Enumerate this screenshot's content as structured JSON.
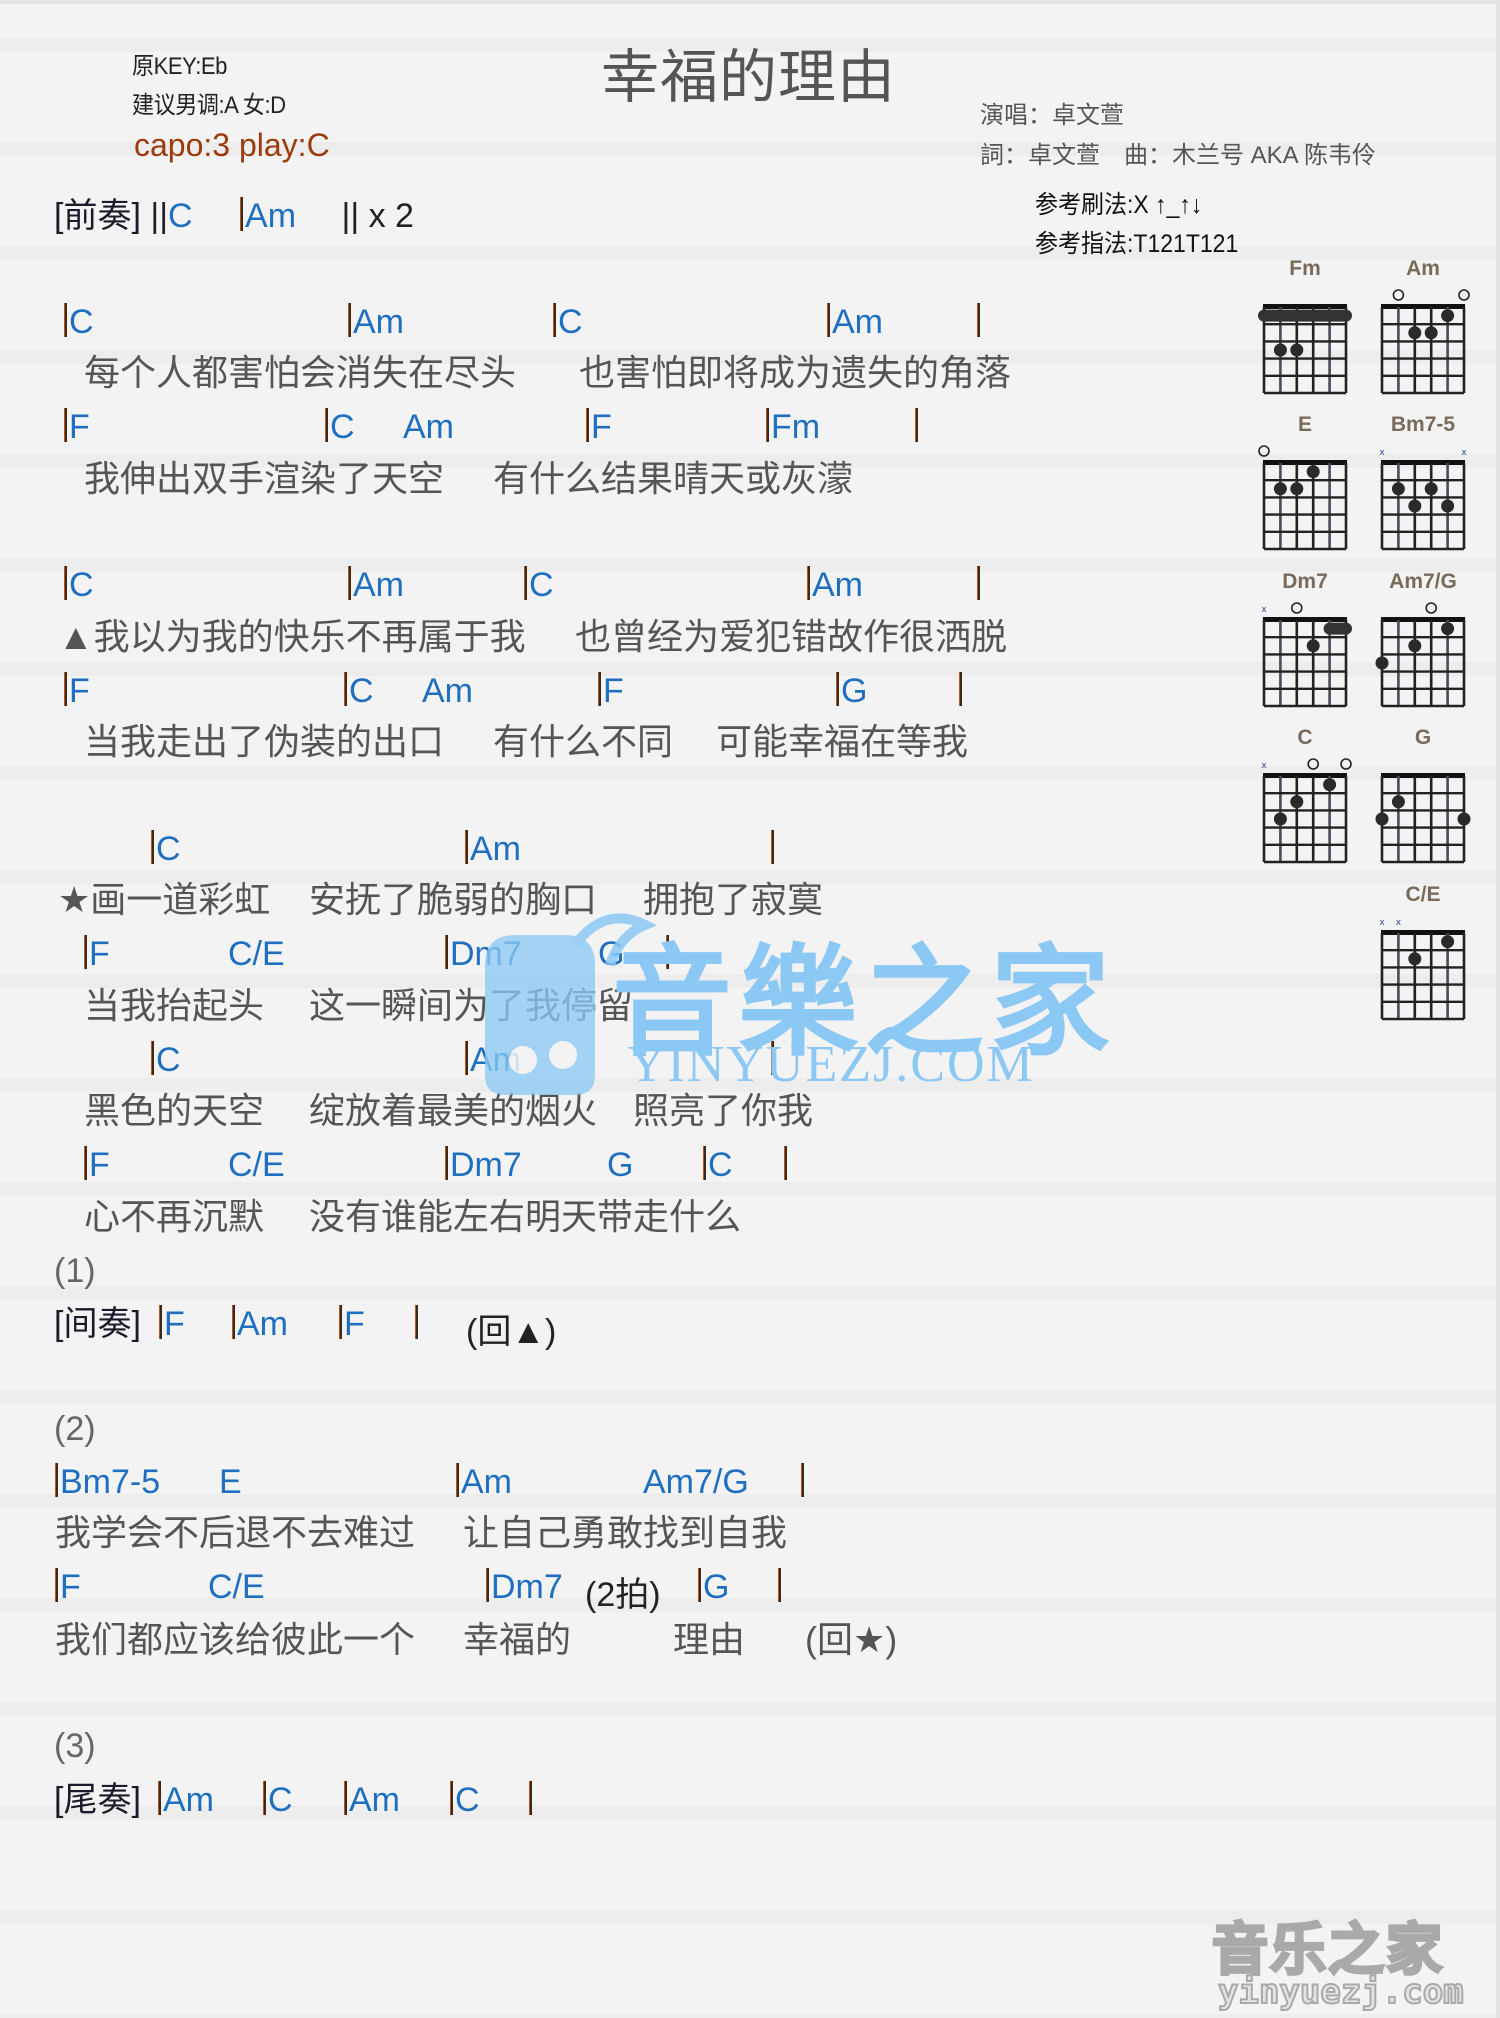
{
  "header": {
    "original_key": "原KEY:Eb",
    "suggested_key": "建议男调:A 女:D",
    "capo": "capo:3 play:C",
    "title": "幸福的理由",
    "singer": "演唱：卓文萱",
    "credits": "詞：卓文萱　曲：木兰号 AKA 陈韦伶",
    "strum_pattern": "参考刷法:X ↑_↑↓",
    "finger_pattern": "参考指法:T121T121"
  },
  "prelude": {
    "label": "[前奏]",
    "open": "||",
    "chords": [
      "C",
      "Am"
    ],
    "close": "|| x 2"
  },
  "verse1": {
    "rows": [
      {
        "chords": [
          "C",
          "Am",
          "C",
          "Am",
          ""
        ]
      },
      {
        "lyrics": [
          "每个人都害怕会消失在尽头",
          "也害怕即将成为遗失的角落"
        ]
      },
      {
        "chords": [
          "F",
          "C",
          "Am",
          "F",
          "Fm",
          ""
        ]
      },
      {
        "lyrics": [
          "我伸出双手渲染了天空",
          "有什么结果晴天或灰濛"
        ]
      }
    ]
  },
  "verse2": {
    "rows": [
      {
        "chords": [
          "C",
          "Am",
          "C",
          "Am",
          ""
        ]
      },
      {
        "lyrics": [
          "▲我以为我的快乐不再属于我",
          "也曾经为爱犯错故作很洒脱"
        ]
      },
      {
        "chords": [
          "F",
          "C",
          "Am",
          "F",
          "G",
          ""
        ]
      },
      {
        "lyrics": [
          "当我走出了伪装的出口",
          "有什么不同",
          "可能幸福在等我"
        ]
      }
    ]
  },
  "chorus": {
    "rows": [
      {
        "chords": [
          "C",
          "Am",
          ""
        ]
      },
      {
        "lyrics": [
          "★画一道彩虹",
          "安抚了脆弱的胸口",
          "拥抱了寂寞"
        ]
      },
      {
        "chords": [
          "F",
          "C/E",
          "Dm7",
          "G",
          ""
        ]
      },
      {
        "lyrics": [
          "当我抬起头",
          "这一瞬间为了我停留"
        ]
      },
      {
        "chords": [
          "C",
          "Am",
          ""
        ]
      },
      {
        "lyrics": [
          "黑色的天空",
          "绽放着最美的烟火",
          "照亮了你我"
        ]
      },
      {
        "chords": [
          "F",
          "C/E",
          "Dm7",
          "G",
          "C",
          ""
        ]
      },
      {
        "lyrics": [
          "心不再沉默",
          "没有谁能左右明天带走什么"
        ]
      }
    ]
  },
  "ending1": {
    "marker": "(1)",
    "label": "[间奏]",
    "chords": [
      "F",
      "Am",
      "F",
      ""
    ],
    "repeat": "(回▲)"
  },
  "ending2": {
    "marker": "(2)",
    "rows": [
      {
        "chords": [
          "Bm7-5",
          "E",
          "Am",
          "Am7/G",
          ""
        ]
      },
      {
        "lyrics": [
          "我学会不后退不去难过",
          "让自己勇敢找到自我"
        ]
      },
      {
        "chords": [
          "F",
          "C/E",
          "Dm7",
          "G",
          ""
        ],
        "note": "(2拍)"
      },
      {
        "lyrics": [
          "我们都应该给彼此一个",
          "幸福的",
          "理由",
          "(回★)"
        ]
      }
    ]
  },
  "ending3": {
    "marker": "(3)",
    "label": "[尾奏]",
    "chords": [
      "Am",
      "C",
      "Am",
      "C",
      ""
    ]
  },
  "chord_diagrams": [
    {
      "name": "Fm",
      "markers": [
        "",
        "",
        "",
        "",
        "",
        ""
      ],
      "barre": {
        "fret": 1,
        "from": 1,
        "to": 6
      },
      "dots": [
        [
          2,
          3
        ],
        [
          3,
          3
        ]
      ]
    },
    {
      "name": "Am",
      "markers": [
        "",
        "o",
        "",
        "",
        "",
        "o"
      ],
      "dots": [
        [
          3,
          2
        ],
        [
          4,
          2
        ],
        [
          5,
          1
        ]
      ]
    },
    {
      "name": "E",
      "markers": [
        "o",
        "",
        "",
        "",
        "",
        ""
      ],
      "dots": [
        [
          2,
          2
        ],
        [
          3,
          2
        ],
        [
          4,
          1
        ]
      ]
    },
    {
      "name": "Bm7-5",
      "markers": [
        "x",
        "",
        "",
        "",
        "",
        "x"
      ],
      "dots": [
        [
          2,
          2
        ],
        [
          4,
          2
        ],
        [
          3,
          3
        ],
        [
          5,
          3
        ]
      ]
    },
    {
      "name": "Dm7",
      "markers": [
        "x",
        "",
        "o",
        "",
        "",
        ""
      ],
      "barre": {
        "fret": 1,
        "from": 5,
        "to": 6
      },
      "dots": [
        [
          4,
          2
        ]
      ]
    },
    {
      "name": "Am7/G",
      "markers": [
        "",
        "",
        "",
        "o",
        "",
        ""
      ],
      "dots": [
        [
          1,
          3
        ],
        [
          3,
          2
        ],
        [
          5,
          1
        ]
      ]
    },
    {
      "name": "C",
      "markers": [
        "x",
        "",
        "",
        "o",
        "",
        "o"
      ],
      "dots": [
        [
          2,
          3
        ],
        [
          3,
          2
        ],
        [
          5,
          1
        ]
      ]
    },
    {
      "name": "G",
      "markers": [
        "",
        "",
        "",
        "",
        "",
        ""
      ],
      "dots": [
        [
          1,
          3
        ],
        [
          2,
          2
        ],
        [
          6,
          3
        ]
      ]
    },
    {
      "name": "C/E",
      "markers": [
        "x",
        "x",
        "",
        "",
        "",
        ""
      ],
      "dots": [
        [
          3,
          2
        ],
        [
          5,
          1
        ]
      ]
    }
  ],
  "watermark": {
    "center_cn": "音樂之家",
    "center_en": "YINYUEZJ.COM",
    "corner_cn": "音乐之家",
    "corner_en": "yinyuezj.com"
  },
  "colors": {
    "chord": "#1f6fc0",
    "capo": "#9c3a0c",
    "watermark": "#8cc8f4"
  }
}
